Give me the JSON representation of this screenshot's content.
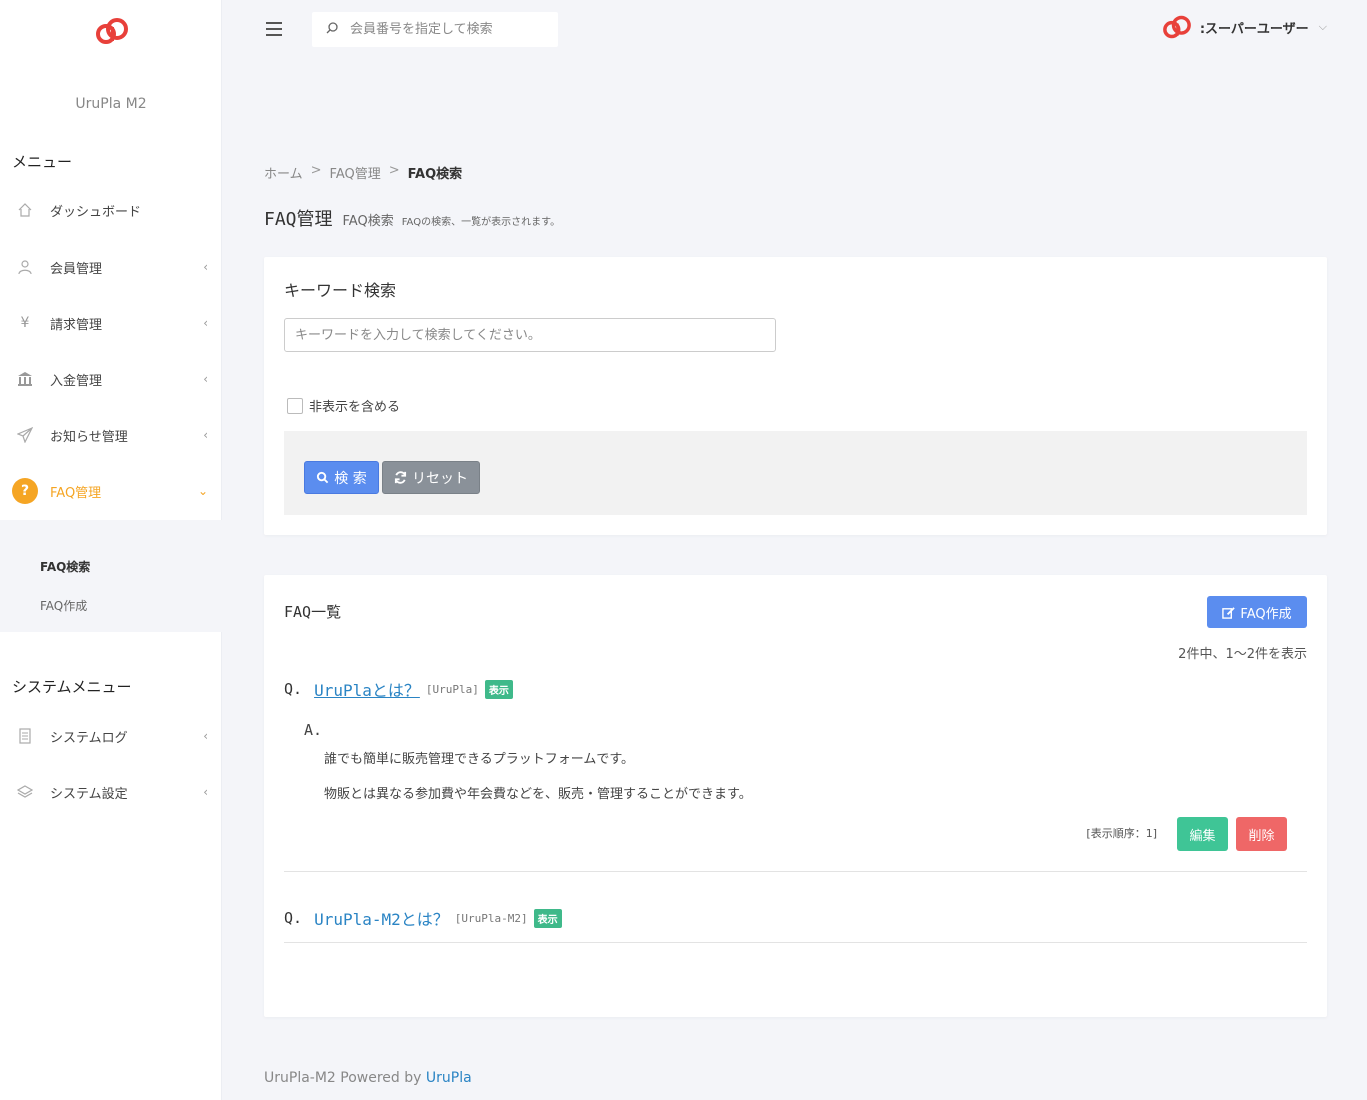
{
  "app": {
    "name": "UruPla M2",
    "brand_color": "#e8403a",
    "accent_color": "#f5a524"
  },
  "topbar": {
    "search_placeholder": "会員番号を指定して検索",
    "user_name": ":スーパーユーザー"
  },
  "sidebar": {
    "menu_heading": "メニュー",
    "items": [
      {
        "label": "ダッシュボード",
        "icon": "home-icon"
      },
      {
        "label": "会員管理",
        "icon": "user-icon"
      },
      {
        "label": "請求管理",
        "icon": "yen-icon"
      },
      {
        "label": "入金管理",
        "icon": "bank-icon"
      },
      {
        "label": "お知らせ管理",
        "icon": "paper-plane-icon"
      },
      {
        "label": "FAQ管理",
        "icon": "question-icon"
      }
    ],
    "faq_sub": [
      {
        "label": "FAQ検索"
      },
      {
        "label": "FAQ作成"
      }
    ],
    "system_heading": "システムメニュー",
    "system_items": [
      {
        "label": "システムログ",
        "icon": "file-icon"
      },
      {
        "label": "システム設定",
        "icon": "layers-icon"
      }
    ]
  },
  "breadcrumb": {
    "home": "ホーム",
    "sep": ">",
    "section": "FAQ管理",
    "current": "FAQ検索"
  },
  "page": {
    "title": "FAQ管理",
    "subtitle": "FAQ検索",
    "description": "FAQの検索、一覧が表示されます。"
  },
  "search_card": {
    "title": "キーワード検索",
    "keyword_placeholder": "キーワードを入力して検索してください。",
    "include_hidden_label": "非表示を含める",
    "search_button": "検 索",
    "reset_button": "リセット"
  },
  "list_card": {
    "title": "FAQ一覧",
    "create_button": "FAQ作成",
    "count_text": "2件中、1〜2件を表示",
    "q_prefix": "Q.",
    "a_prefix": "A.",
    "faqs": [
      {
        "question": "UruPlaとは？",
        "category": "[UruPla]",
        "status": "表示",
        "answer_lines": [
          "誰でも簡単に販売管理できるプラットフォームです。",
          "物販とは異なる参加費や年会費などを、販売・管理することができます。"
        ],
        "order": "[表示順序：1]",
        "edit_button": "編集",
        "delete_button": "削除"
      },
      {
        "question": "UruPla-M2とは？",
        "category": "[UruPla-M2]",
        "status": "表示"
      }
    ]
  },
  "footer": {
    "text": "UruPla-M2 Powered by",
    "link": "UruPla"
  }
}
